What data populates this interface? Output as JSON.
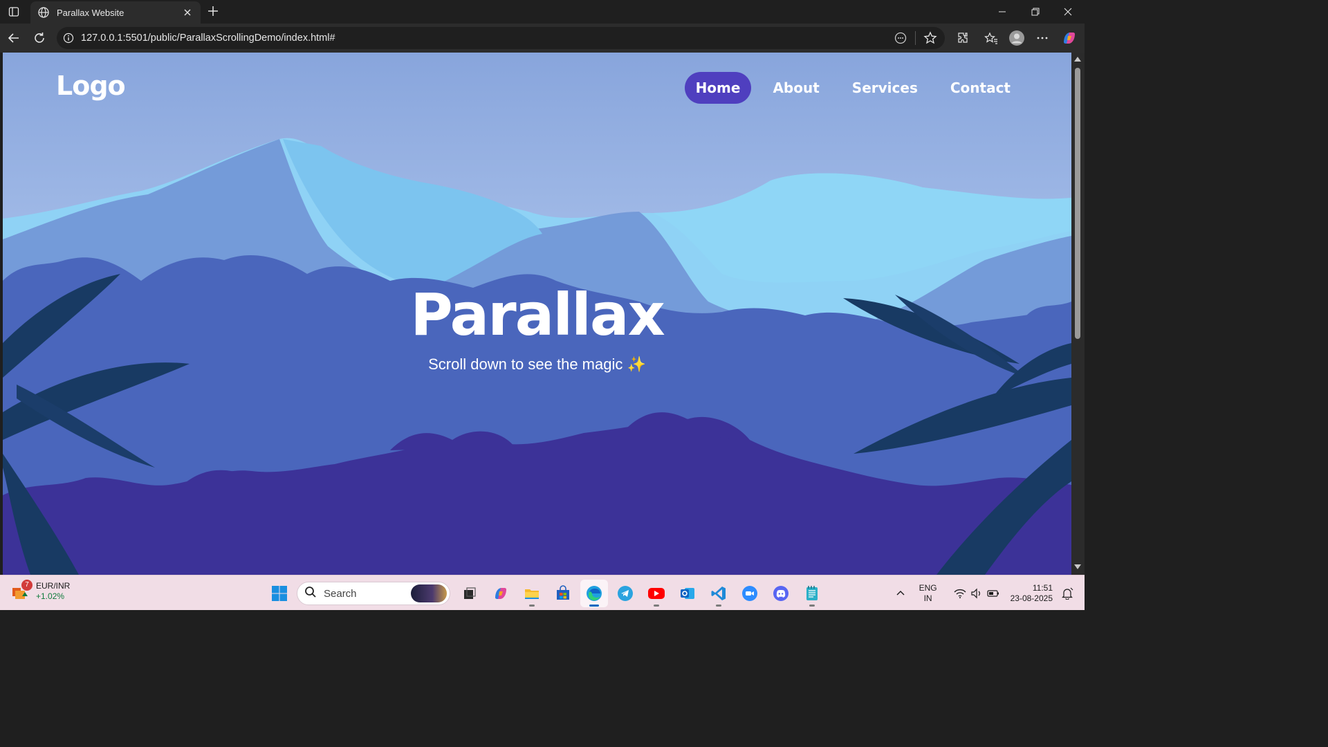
{
  "browser": {
    "tab_title": "Parallax Website",
    "url": "127.0.0.1:5501/public/ParallaxScrollingDemo/index.html#"
  },
  "page": {
    "logo": "Logo",
    "nav": [
      {
        "label": "Home",
        "active": true
      },
      {
        "label": "About",
        "active": false
      },
      {
        "label": "Services",
        "active": false
      },
      {
        "label": "Contact",
        "active": false
      }
    ],
    "hero_title": "Parallax",
    "hero_subtitle": "Scroll down to see the magic ✨",
    "colors": {
      "accent": "#4f3fbf",
      "sky": "#a7c0ea",
      "mountains_far": "#6d8fd6",
      "mountains_near": "#86cdf2",
      "jungle_mid": "#4a67bd",
      "jungle_front": "#3c3199",
      "leaves": "#183a63"
    }
  },
  "taskbar": {
    "widget": {
      "badge": "7",
      "symbol": "EUR/INR",
      "change": "+1.02%"
    },
    "search_placeholder": "Search",
    "apps": [
      "task-view",
      "copilot",
      "file-explorer",
      "microsoft-store",
      "edge",
      "telegram",
      "youtube",
      "outlook",
      "vscode",
      "zoom",
      "discord",
      "notepad"
    ],
    "active_app": "edge",
    "lang_line1": "ENG",
    "lang_line2": "IN",
    "time": "11:51",
    "date": "23-08-2025"
  }
}
